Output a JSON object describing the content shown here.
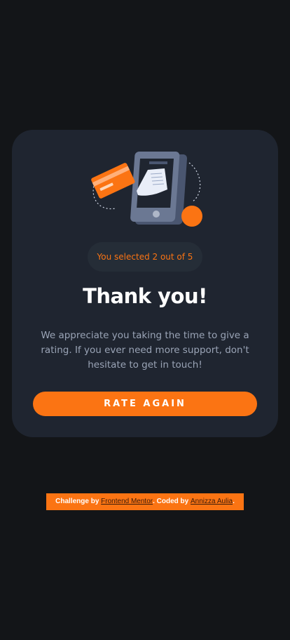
{
  "card": {
    "badge_text": "You selected 2 out of 5",
    "title": "Thank you!",
    "description": "We appreciate you taking the time to give a rating. If you ever need more support, don't hesitate to get in touch!",
    "button_label": "RATE AGAIN"
  },
  "attribution": {
    "challenge_prefix": "Challenge by ",
    "challenge_link": "Frontend Mentor",
    "separator": ". Coded by ",
    "author_link": "Annizza Aulia",
    "suffix": "."
  },
  "colors": {
    "background": "#131518",
    "card": "#1f2530",
    "accent": "#fb7413",
    "text_muted": "#9aa4b6"
  },
  "icons": [
    "phone-receipt-illustration",
    "card-icon"
  ]
}
